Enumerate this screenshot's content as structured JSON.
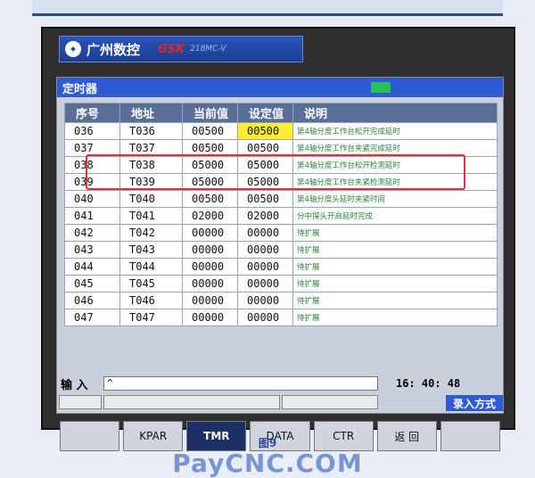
{
  "brand": {
    "company": "广州数控",
    "logo_gsk": "GSK",
    "model": "218MC-V"
  },
  "window": {
    "title": "定时器",
    "title_indicator_color": "#27c25a"
  },
  "table": {
    "headers": [
      "序号",
      "地址",
      "当前值",
      "设定值",
      "说明"
    ],
    "rows": [
      {
        "no": "036",
        "addr": "T036",
        "cur": "00500",
        "set": "00500",
        "desc": "第4轴分度工作台松开完成延时",
        "hl": true
      },
      {
        "no": "037",
        "addr": "T037",
        "cur": "00500",
        "set": "00500",
        "desc": "第4轴分度工作台夹紧完成延时",
        "hl": false
      },
      {
        "no": "038",
        "addr": "T038",
        "cur": "05000",
        "set": "05000",
        "desc": "第4轴分度工作台松开检测延时",
        "hl": false
      },
      {
        "no": "039",
        "addr": "T039",
        "cur": "05000",
        "set": "05000",
        "desc": "第4轴分度工作台夹紧检测延时",
        "hl": false
      },
      {
        "no": "040",
        "addr": "T040",
        "cur": "00500",
        "set": "00500",
        "desc": "第4轴分度头延时夹紧时间",
        "hl": false
      },
      {
        "no": "041",
        "addr": "T041",
        "cur": "02000",
        "set": "02000",
        "desc": "分中探头开启延时完成",
        "hl": false
      },
      {
        "no": "042",
        "addr": "T042",
        "cur": "00000",
        "set": "00000",
        "desc": "待扩展",
        "hl": false
      },
      {
        "no": "043",
        "addr": "T043",
        "cur": "00000",
        "set": "00000",
        "desc": "待扩展",
        "hl": false
      },
      {
        "no": "044",
        "addr": "T044",
        "cur": "00000",
        "set": "00000",
        "desc": "待扩展",
        "hl": false
      },
      {
        "no": "045",
        "addr": "T045",
        "cur": "00000",
        "set": "00000",
        "desc": "待扩展",
        "hl": false
      },
      {
        "no": "046",
        "addr": "T046",
        "cur": "00000",
        "set": "00000",
        "desc": "待扩展",
        "hl": false
      },
      {
        "no": "047",
        "addr": "T047",
        "cur": "00000",
        "set": "00000",
        "desc": "待扩展",
        "hl": false
      }
    ]
  },
  "input": {
    "label": "输 入",
    "value": "^",
    "clock": "16: 40: 48"
  },
  "status": {
    "mode": "录入方式"
  },
  "softkeys": [
    {
      "label": "",
      "active": false
    },
    {
      "label": "KPAR",
      "active": false
    },
    {
      "label": "TMR",
      "active": true
    },
    {
      "label": "DATA",
      "active": false
    },
    {
      "label": "CTR",
      "active": false
    },
    {
      "label": "返 回",
      "active": false
    },
    {
      "label": "",
      "active": false
    }
  ],
  "caption": {
    "figure": "图9",
    "watermark": "PayCNC.COM"
  }
}
